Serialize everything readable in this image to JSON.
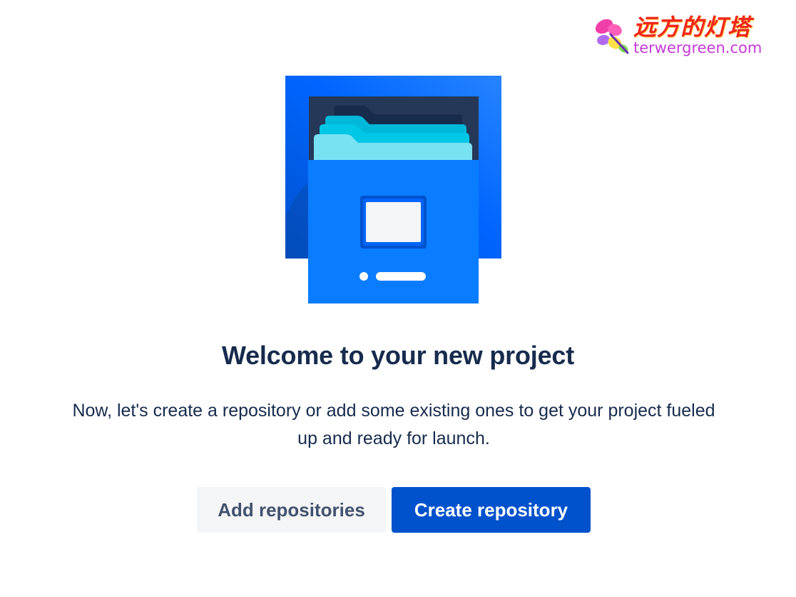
{
  "watermark": {
    "chinese_text": "远方的灯塔",
    "url_text": "terwergreen.com"
  },
  "empty_state": {
    "title": "Welcome to your new project",
    "description": "Now, let's create a repository or add some existing ones to get your project fueled up and ready for launch."
  },
  "actions": {
    "add_repositories_label": "Add repositories",
    "create_repository_label": "Create repository"
  },
  "colors": {
    "primary_button": "#0052cc",
    "secondary_button": "#f4f5f7",
    "heading_text": "#172b4d",
    "illustration_blue": "#0065ff",
    "illustration_teal": "#00c7e6"
  },
  "icons": {
    "illustration": "open-file-drawer-icon",
    "watermark_logo": "butterfly-icon"
  }
}
